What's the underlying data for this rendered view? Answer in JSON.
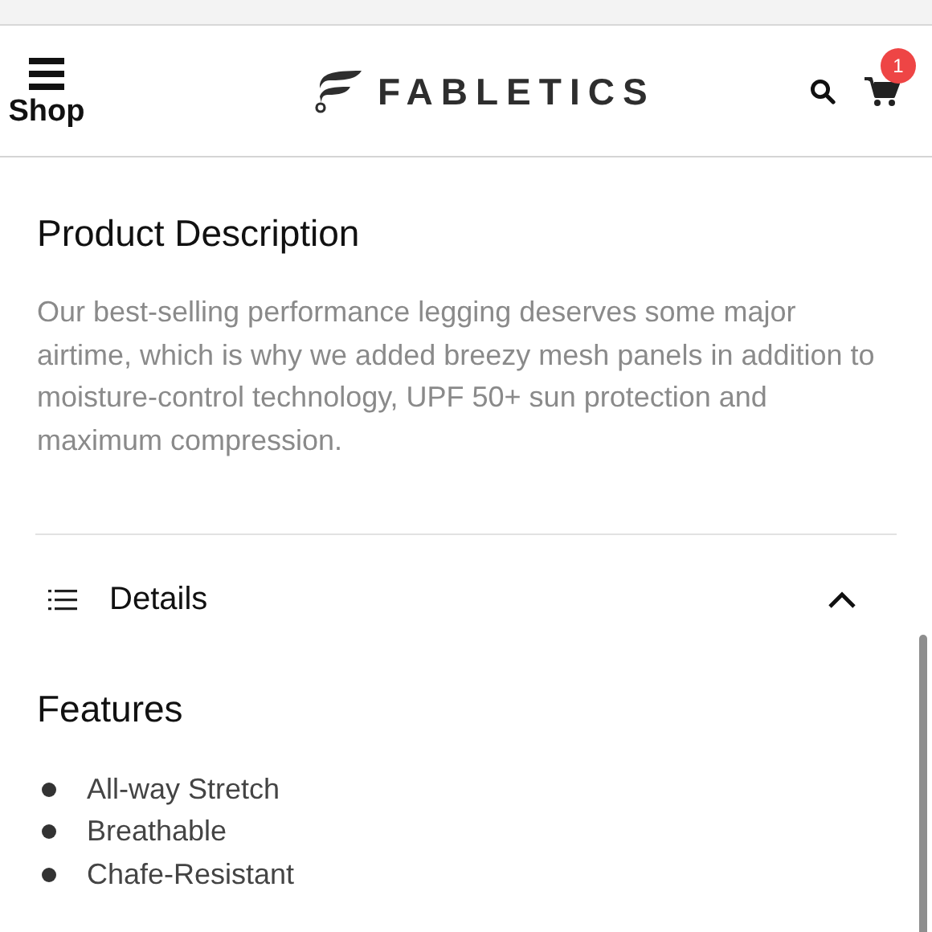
{
  "header": {
    "menu_label": "Shop",
    "brand": "FABLETICS",
    "cart_count": "1"
  },
  "description": {
    "title": "Product Description",
    "text": "Our best-selling performance legging deserves some major airtime, which is why we added breezy mesh panels in addition to moisture-control technology, UPF 50+ sun protection and maximum compression."
  },
  "details": {
    "label": "Details",
    "expanded": true,
    "features_title": "Features",
    "features": [
      "All-way Stretch",
      "Breathable",
      "Chafe-Resistant"
    ]
  }
}
